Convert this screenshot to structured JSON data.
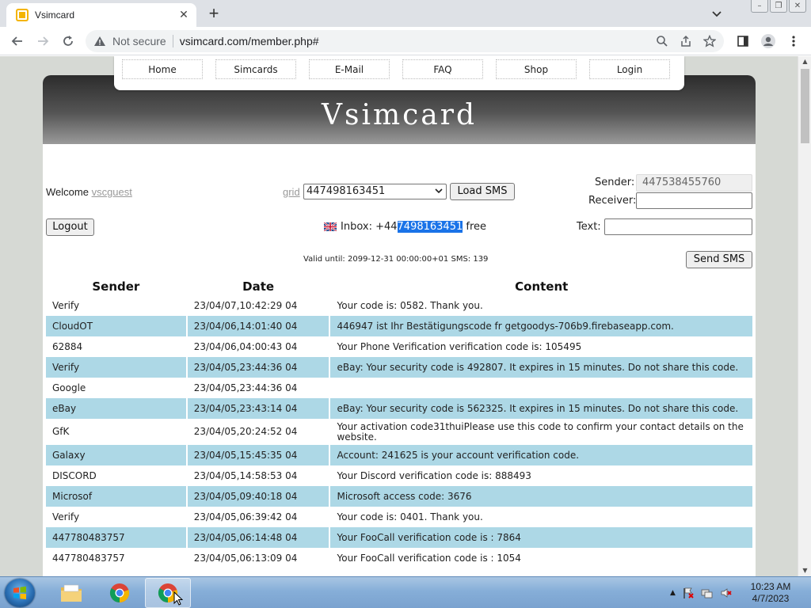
{
  "browser": {
    "tab_title": "Vsimcard",
    "tab_close": "✕",
    "new_tab": "+",
    "not_secure": "Not secure",
    "url": "vsimcard.com/member.php#"
  },
  "site": {
    "brand": "Vsimcard",
    "nav": [
      "Home",
      "Simcards",
      "E-Mail",
      "FAQ",
      "Shop",
      "Login"
    ]
  },
  "controls": {
    "welcome_label": "Welcome",
    "welcome_user": "vscguest",
    "grid_link": "grid",
    "selected_number": "447498163451",
    "load_sms": "Load SMS",
    "sender_label": "Sender:",
    "sender_value": "447538455760",
    "receiver_label": "Receiver:",
    "receiver_value": "",
    "logout": "Logout",
    "inbox_prefix": "Inbox: +44",
    "inbox_highlight": "7498163451",
    "inbox_suffix": " free",
    "text_label": "Text:",
    "text_value": "",
    "valid_until": "Valid until: 2099-12-31 00:00:00+01 SMS: 139",
    "send_sms": "Send SMS"
  },
  "table": {
    "headers": [
      "Sender",
      "Date",
      "Content"
    ],
    "rows": [
      {
        "sender": "Verify",
        "date": "23/04/07,10:42:29 04",
        "content": "Your code is: 0582. Thank you."
      },
      {
        "sender": "CloudOT",
        "date": "23/04/06,14:01:40 04",
        "content": "446947 ist Ihr Bestätigungscode fr getgoodys-706b9.firebaseapp.com."
      },
      {
        "sender": "62884",
        "date": "23/04/06,04:00:43 04",
        "content": "Your Phone Verification verification code is: 105495"
      },
      {
        "sender": "Verify",
        "date": "23/04/05,23:44:36 04",
        "content": "eBay: Your security code is 492807. It expires in 15 minutes. Do not share this code."
      },
      {
        "sender": "Google",
        "date": "23/04/05,23:44:36 04",
        "content": ""
      },
      {
        "sender": "eBay",
        "date": "23/04/05,23:43:14 04",
        "content": "eBay: Your security code is 562325. It expires in 15 minutes. Do not share this code."
      },
      {
        "sender": "GfK",
        "date": "23/04/05,20:24:52 04",
        "content": "Your activation code31thuiPlease use this code to confirm your contact details on the website."
      },
      {
        "sender": "Galaxy",
        "date": "23/04/05,15:45:35 04",
        "content": "Account: 241625 is your account verification code."
      },
      {
        "sender": "DISCORD",
        "date": "23/04/05,14:58:53 04",
        "content": "Your Discord verification code is: 888493"
      },
      {
        "sender": "Microsof",
        "date": "23/04/05,09:40:18 04",
        "content": "Microsoft access code: 3676"
      },
      {
        "sender": "Verify",
        "date": "23/04/05,06:39:42 04",
        "content": "Your code is: 0401. Thank you."
      },
      {
        "sender": "447780483757",
        "date": "23/04/05,06:14:48 04",
        "content": "Your FooCall verification code is : 7864"
      },
      {
        "sender": "447780483757",
        "date": "23/04/05,06:13:09 04",
        "content": "Your FooCall verification code is : 1054"
      }
    ]
  },
  "taskbar": {
    "time": "10:23 AM",
    "date": "4/7/2023"
  },
  "colors": {
    "row_alt": "#add8e6",
    "selection": "#1a73e8"
  }
}
